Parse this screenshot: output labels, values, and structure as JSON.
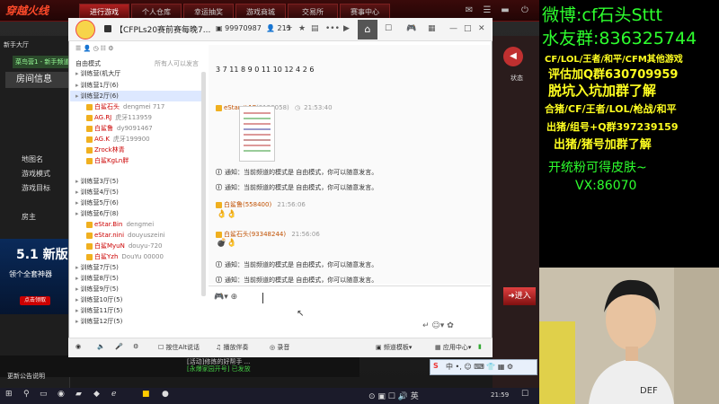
{
  "game": {
    "logo": "穿越火线",
    "tabs": [
      "进行游戏",
      "个人仓库",
      "幸运抽奖",
      "游戏商城",
      "交易所",
      "赛事中心"
    ],
    "active_tab": 0,
    "left_title": "新手大厅",
    "channel": "菜鸟营1 - 新手频道",
    "room_info": "房间信息",
    "menu": [
      "地图名",
      "游戏模式",
      "游戏目标",
      "房主"
    ],
    "promo_big": "5.1 新版",
    "promo_sub": "领个全套神器",
    "promo_btn": "点击领取",
    "state_label": "状态",
    "enter_label": "进入",
    "notice_title": "更新公告说明",
    "notice_1": "[活动]修炼的好帮手 ...",
    "notice_2": "[永爆家园开号] 已发放"
  },
  "yy": {
    "title": "【CFPLs20赛前赛每晚7...",
    "channel_id": "99970987",
    "online": "215",
    "mode": "自由模式",
    "mode_right": "所有人可以发言",
    "tree": [
      {
        "t": "group",
        "label": "训练营(机大厅"
      },
      {
        "t": "group",
        "label": "训练营1厅(6)"
      },
      {
        "t": "group",
        "label": "训练营2厅(6)",
        "sel": true
      },
      {
        "t": "user",
        "name": "白鲨石头",
        "sub": "dengmei 717"
      },
      {
        "t": "user",
        "name": "AG.RJ",
        "sub": "虎牙113959"
      },
      {
        "t": "user",
        "name": "白鲨鲁",
        "sub": "dy9091467"
      },
      {
        "t": "user",
        "name": "AG.K",
        "sub": "虎牙199900"
      },
      {
        "t": "user",
        "name": "Zrock林青",
        "sub": ""
      },
      {
        "t": "user",
        "name": "白鲨KgLn胖",
        "sub": ""
      },
      {
        "t": "group",
        "label": "训练营3厅(5)"
      },
      {
        "t": "group",
        "label": "训练营4厅(5)"
      },
      {
        "t": "group",
        "label": "训练营5厅(6)"
      },
      {
        "t": "group",
        "label": "训练营6厅(8)"
      },
      {
        "t": "user",
        "name": "eStar.Bin",
        "sub": "dengmei"
      },
      {
        "t": "user",
        "name": "eStar.nini",
        "sub": "douyuszeini"
      },
      {
        "t": "user",
        "name": "白鲨MyuN",
        "sub": "douyu-720"
      },
      {
        "t": "user",
        "name": "白鲨Yzh",
        "sub": "DouYu 00000"
      },
      {
        "t": "group",
        "label": "训练营7厅(5)"
      },
      {
        "t": "group",
        "label": "训练营8厅(5)"
      },
      {
        "t": "group",
        "label": "训练营9厅(5)"
      },
      {
        "t": "group",
        "label": "训练营10厅(5)"
      },
      {
        "t": "group",
        "label": "训练营11厅(5)"
      },
      {
        "t": "group",
        "label": "训练营12厅(5)"
      }
    ],
    "chat": {
      "digits": "3 7 11 8 9 0 11 10 12 4 2 6",
      "m1_sender": "eStar.ハ1E",
      "m1_id": "(9123058)",
      "m1_time": "21:53:40",
      "sys": "通知：当前频道的模式是 自由模式，你可以随意发言。",
      "m2_sender": "白鲨鲁(558400)",
      "m2_time": "21:56:06",
      "m2_emoji": "👌👌",
      "m3_sender": "白鲨石头(93348244)",
      "m3_time": "21:56:06",
      "m3_emoji": "💣👌"
    },
    "bottom": [
      "按住Alt说话",
      "播放伴奏",
      "录音",
      "频道模板",
      "应用中心"
    ]
  },
  "taskbar": {
    "time": "21:59"
  },
  "overlay": {
    "l1": "微博:cf石头Sttt",
    "l2": "水友群:836325744",
    "l3": "CF/LOL/王者/和平/CFM其他游戏",
    "l4": "评估加Q群630709959",
    "l5": "脱坑入坑加群了解",
    "l6": "合猪/CF/王者/LOL/枪战/和平",
    "l7": "出猪/组号+Q群397239159",
    "l8": "出猪/猪号加群了解",
    "l9": "开统粉可得皮肤~",
    "l10": "VX:86070"
  }
}
